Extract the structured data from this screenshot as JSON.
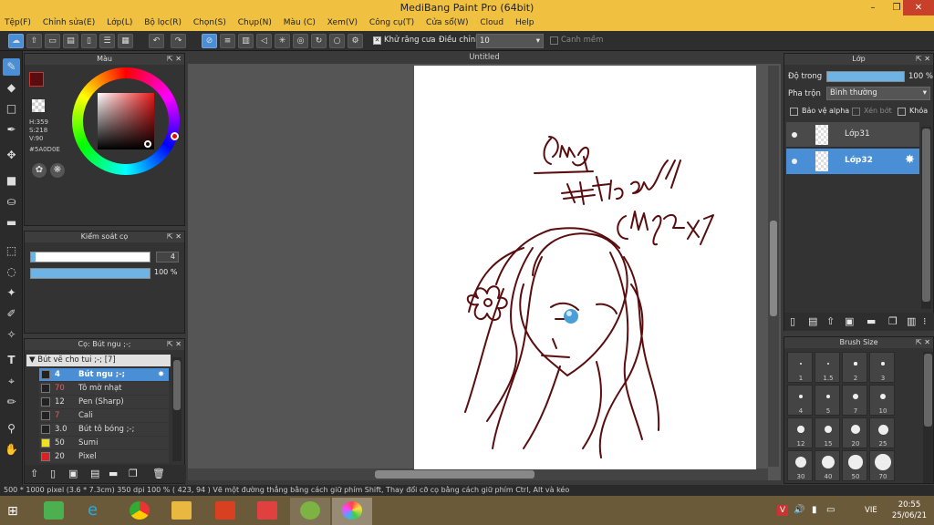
{
  "app": {
    "title": "MediBang Paint Pro (64bit)",
    "menus": [
      "Tệp(F)",
      "Chỉnh sửa(E)",
      "Lớp(L)",
      "Bộ lọc(R)",
      "Chọn(S)",
      "Chụp(N)",
      "Màu (C)",
      "Xem(V)",
      "Công cụ(T)",
      "Cửa sổ(W)",
      "Cloud",
      "Help"
    ]
  },
  "toolbar": {
    "antialias_label": "Khử răng cưa",
    "correction_label": "Điều chỉnh",
    "correction_value": "10",
    "margin_label": "Canh mềm"
  },
  "color_panel": {
    "title": "Màu",
    "h": "H:359",
    "s": "S:218",
    "v": "V:90",
    "hex": "#5A0D0E",
    "fg_color": "#5a0d0e"
  },
  "brush_control": {
    "title": "Kiểm soát cọ",
    "size_value": "4",
    "opacity_value": "100 %"
  },
  "brush_panel": {
    "title": "Cọ: Bút ngu ;-;",
    "group": "Bút vẽ cho tui ;-; [7]",
    "items": [
      {
        "size": "4",
        "name": "Bút ngu ;-;",
        "color": "#222222"
      },
      {
        "size": "70",
        "name": "Tô mờ nhạt",
        "color": "#222222"
      },
      {
        "size": "12",
        "name": "Pen (Sharp)",
        "color": "#222222"
      },
      {
        "size": "7",
        "name": "Cali",
        "color": "#222222"
      },
      {
        "size": "3.0",
        "name": "Bút tô bóng ;-;",
        "color": "#222222"
      },
      {
        "size": "50",
        "name": "Sumi",
        "color": "#f0e020"
      },
      {
        "size": "20",
        "name": "Pixel",
        "color": "#e02020"
      }
    ]
  },
  "canvas": {
    "tab": "Untitled"
  },
  "layer_panel": {
    "title": "Lớp",
    "opacity_label": "Độ trong",
    "opacity_value": "100 %",
    "blend_label": "Pha trộn",
    "blend_value": "Bình thường",
    "protect_alpha": "Bảo vệ alpha",
    "clip": "Xén bớt",
    "lock": "Khóa",
    "layers": [
      "Lớp31",
      "Lớp32"
    ]
  },
  "brush_size_panel": {
    "title": "Brush Size",
    "sizes": [
      "1",
      "1.5",
      "2",
      "3",
      "4",
      "5",
      "7",
      "10",
      "12",
      "15",
      "20",
      "25",
      "30",
      "40",
      "50",
      "70"
    ]
  },
  "status": {
    "text": "500 * 1000 pixel   (3.6 * 7.3cm)   350 dpi   100 %   ( 423, 94 )   Vẽ một đường thẳng bằng cách giữ phím Shift, Thay đổi cỡ cọ bằng cách giữ phím Ctrl, Alt và kéo"
  },
  "taskbar": {
    "lang": "VIE",
    "time": "20:55",
    "date": "25/06/21"
  },
  "drawing": {
    "stroke_color": "#5a0d0e"
  }
}
